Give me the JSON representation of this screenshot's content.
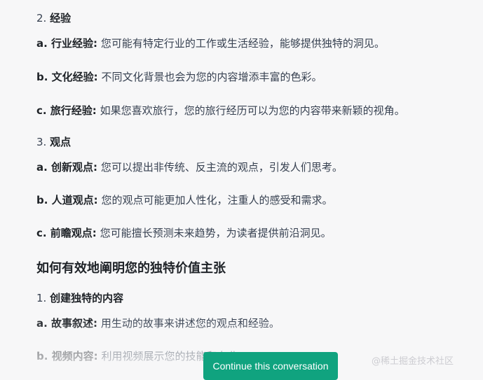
{
  "sections": {
    "experience": {
      "heading_num": "2.",
      "heading": "经验",
      "items": [
        {
          "label": "a. 行业经验:",
          "text": "您可能有特定行业的工作或生活经验，能够提供独特的洞见。"
        },
        {
          "label": "b. 文化经验:",
          "text": "不同文化背景也会为您的内容增添丰富的色彩。"
        },
        {
          "label": "c. 旅行经验:",
          "text": "如果您喜欢旅行，您的旅行经历可以为您的内容带来新颖的视角。"
        }
      ]
    },
    "viewpoints": {
      "heading_num": "3.",
      "heading": "观点",
      "items": [
        {
          "label": "a. 创新观点:",
          "text": "您可以提出非传统、反主流的观点，引发人们思考。"
        },
        {
          "label": "b. 人道观点:",
          "text": "您的观点可能更加人性化，注重人的感受和需求。"
        },
        {
          "label": "c. 前瞻观点:",
          "text": "您可能擅长预测未来趋势，为读者提供前沿洞见。"
        }
      ]
    },
    "value_prop": {
      "title": "如何有效地阐明您的独特价值主张",
      "sub_num": "1.",
      "sub_heading": "创建独特的内容",
      "items": [
        {
          "label": "a. 故事叙述:",
          "text": "用生动的故事来讲述您的观点和经验。"
        },
        {
          "label": "b. 视频内容:",
          "text": "利用视频展示您的技能和专业"
        }
      ]
    }
  },
  "continue_button": {
    "label": "Continue this conversation",
    "color": "#10a37f"
  },
  "watermark": "@稀土掘金技术社区"
}
